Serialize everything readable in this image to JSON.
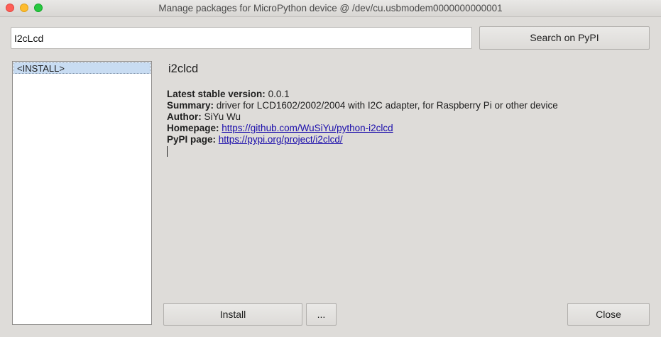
{
  "window": {
    "title": "Manage packages for MicroPython device @ /dev/cu.usbmodem0000000000001"
  },
  "search": {
    "value": "I2cLcd",
    "button_label": "Search on PyPI"
  },
  "package_list": {
    "items": [
      "<INSTALL>"
    ],
    "selected_index": 0
  },
  "package_info": {
    "name": "i2clcd",
    "latest_version_label": "Latest stable version:",
    "latest_version": "0.0.1",
    "summary_label": "Summary:",
    "summary": "driver for LCD1602/2002/2004 with I2C adapter, for Raspberry Pi or other device",
    "author_label": "Author:",
    "author": "SiYu Wu",
    "homepage_label": "Homepage:",
    "homepage": "https://github.com/WuSiYu/python-i2clcd",
    "pypi_label": "PyPI page:",
    "pypi": "https://pypi.org/project/i2clcd/"
  },
  "actions": {
    "install_label": "Install",
    "more_label": "...",
    "close_label": "Close"
  },
  "colors": {
    "selection": "#c8dcf2",
    "link": "#1a0dab",
    "close_dot": "#fe5f57",
    "minimize_dot": "#febc2e",
    "maximize_dot": "#28c840"
  }
}
